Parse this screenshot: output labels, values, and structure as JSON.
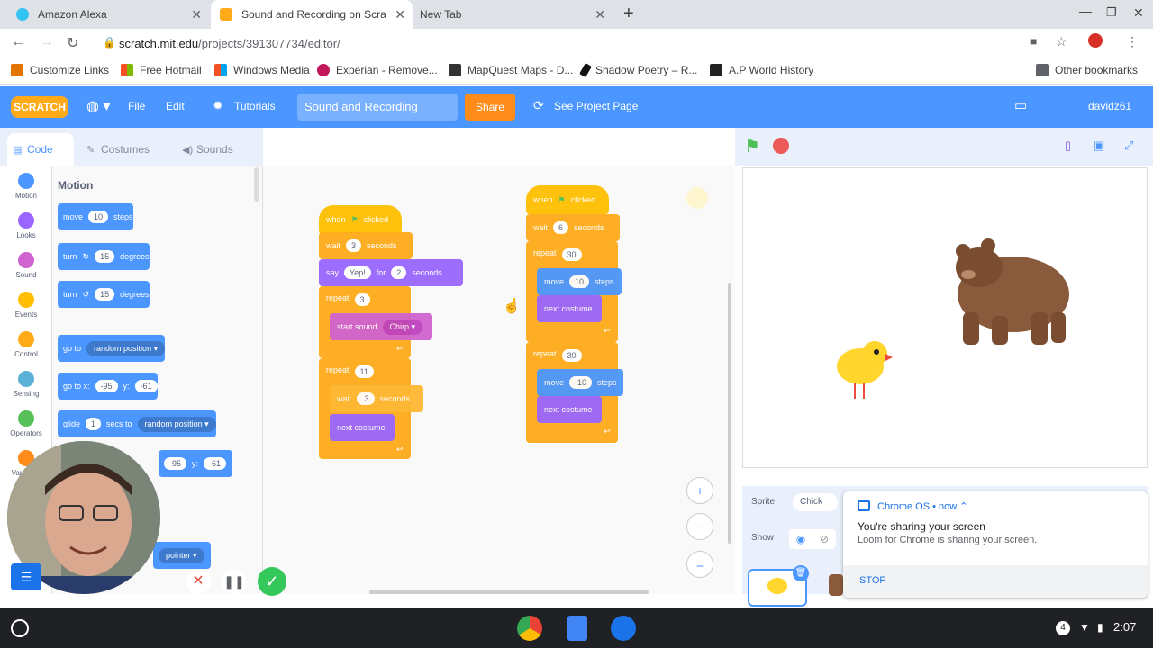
{
  "browser": {
    "tabs": [
      {
        "label": "Amazon Alexa"
      },
      {
        "label": "Sound and Recording on Scratch"
      },
      {
        "label": "New Tab"
      }
    ],
    "url_domain": "scratch.mit.edu",
    "url_path": "/projects/391307734/editor/",
    "bookmarks": [
      "Customize Links",
      "Free Hotmail",
      "Windows Media",
      "Experian - Remove...",
      "MapQuest Maps - D...",
      "Shadow Poetry – R...",
      "A.P World History",
      "Other bookmarks"
    ]
  },
  "menu": {
    "logo": "SCRATCH",
    "file": "File",
    "edit": "Edit",
    "tutorials": "Tutorials",
    "project_title": "Sound and Recording",
    "share": "Share",
    "see_project_page": "See Project Page",
    "username": "davidz61"
  },
  "editor_tabs": {
    "code": "Code",
    "costumes": "Costumes",
    "sounds": "Sounds"
  },
  "categories": [
    {
      "label": "Motion",
      "color": "#4c97ff"
    },
    {
      "label": "Looks",
      "color": "#9966ff"
    },
    {
      "label": "Sound",
      "color": "#cf63cf"
    },
    {
      "label": "Events",
      "color": "#ffbf00"
    },
    {
      "label": "Control",
      "color": "#ffab19"
    },
    {
      "label": "Sensing",
      "color": "#5cb1d6"
    },
    {
      "label": "Operators",
      "color": "#59c059"
    },
    {
      "label": "Variables",
      "color": "#ff8c1a"
    }
  ],
  "palette": {
    "heading": "Motion",
    "move": {
      "a": "move",
      "n": "10",
      "b": "steps"
    },
    "turn_right": {
      "a": "turn",
      "n": "15",
      "b": "degrees"
    },
    "turn_left": {
      "a": "turn",
      "n": "15",
      "b": "degrees"
    },
    "go_to": {
      "a": "go to",
      "d": "random position"
    },
    "go_to_xy": {
      "a": "go to x:",
      "x": "-95",
      "b": "y:",
      "y": "-61"
    },
    "glide": {
      "a": "glide",
      "n": "1",
      "b": "secs to",
      "d": "random position"
    },
    "glide_xy": {
      "x": "-95",
      "b": "y:",
      "y": "-61"
    },
    "pointer": "pointer"
  },
  "script1": {
    "hat": "when",
    "hat2": "clicked",
    "wait1": {
      "a": "wait",
      "n": "3",
      "b": "seconds"
    },
    "say": {
      "a": "say",
      "t": "Yep!",
      "b": "for",
      "n": "2",
      "c": "seconds"
    },
    "repeat1": {
      "a": "repeat",
      "n": "3"
    },
    "start_sound": {
      "a": "start sound",
      "d": "Chirp"
    },
    "repeat2": {
      "a": "repeat",
      "n": "11"
    },
    "wait2": {
      "a": "wait",
      "n": ".3",
      "b": "seconds"
    },
    "next_costume": "next costume"
  },
  "script2": {
    "hat": "when",
    "hat2": "clicked",
    "wait": {
      "a": "wait",
      "n": "6",
      "b": "seconds"
    },
    "repeat1": {
      "a": "repeat",
      "n": "30"
    },
    "move1": {
      "a": "move",
      "n": "10",
      "b": "steps"
    },
    "next1": "next costume",
    "repeat2": {
      "a": "repeat",
      "n": "30"
    },
    "move2": {
      "a": "move",
      "n": "-10",
      "b": "steps"
    },
    "next2": "next costume"
  },
  "sprite_info": {
    "sprite_label": "Sprite",
    "sprite_name": "Chick",
    "show_label": "Show"
  },
  "notification": {
    "source": "Chrome OS",
    "time": "now",
    "title": "You're sharing your screen",
    "body": "Loom for Chrome is sharing your screen.",
    "stop": "STOP"
  },
  "taskbar": {
    "time": "2:07",
    "badge": "4"
  }
}
